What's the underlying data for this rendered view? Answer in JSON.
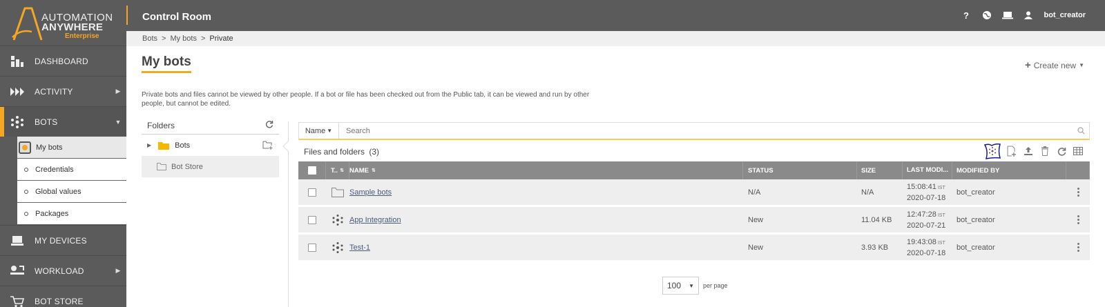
{
  "brand": {
    "line1": "AUTOMATION",
    "line2": "ANYWHERE",
    "line3": "Enterprise"
  },
  "topbar": {
    "title": "Control Room",
    "username": "bot_creator"
  },
  "sidebar": {
    "items": [
      {
        "label": "DASHBOARD",
        "icon": "dashboard-icon"
      },
      {
        "label": "ACTIVITY",
        "icon": "activity-icon"
      },
      {
        "label": "BOTS",
        "icon": "bots-icon"
      },
      {
        "label": "MY DEVICES",
        "icon": "devices-icon"
      },
      {
        "label": "WORKLOAD",
        "icon": "workload-icon"
      },
      {
        "label": "BOT STORE",
        "icon": "cart-icon"
      }
    ],
    "bots_sub": [
      {
        "label": "My bots"
      },
      {
        "label": "Credentials"
      },
      {
        "label": "Global values"
      },
      {
        "label": "Packages"
      }
    ]
  },
  "breadcrumb": {
    "b1": "Bots",
    "sep": ">",
    "b2": "My bots",
    "b3": "Private"
  },
  "page": {
    "title": "My bots",
    "create_new": "Create new",
    "description": "Private bots and files cannot be viewed by other people. If a bot or file has been checked out from the Public tab, it can be viewed and run by other people, but cannot be edited."
  },
  "folders": {
    "header": "Folders",
    "items": [
      {
        "label": "Bots"
      },
      {
        "label": "Bot Store"
      }
    ]
  },
  "search": {
    "filter": "Name",
    "placeholder": "Search"
  },
  "files": {
    "label": "Files and folders",
    "count": "(3)"
  },
  "table": {
    "headers": {
      "type": "T..",
      "name": "NAME",
      "status": "STATUS",
      "size": "SIZE",
      "modified": "LAST MODI...",
      "modified_by": "MODIFIED BY"
    },
    "rows": [
      {
        "type": "folder",
        "name": "Sample bots",
        "status": "N/A",
        "size": "N/A",
        "time": "15:08:41",
        "tz": "IST",
        "date": "2020-07-18",
        "by": "bot_creator"
      },
      {
        "type": "bot",
        "name": "App Integration",
        "status": "New",
        "size": "11.04 KB",
        "time": "12:47:28",
        "tz": "IST",
        "date": "2020-07-21",
        "by": "bot_creator"
      },
      {
        "type": "bot",
        "name": "Test-1",
        "status": "New",
        "size": "3.93 KB",
        "time": "19:43:08",
        "tz": "IST",
        "date": "2020-07-18",
        "by": "bot_creator"
      }
    ]
  },
  "pager": {
    "value": "100",
    "label": "per page"
  },
  "colors": {
    "accent": "#f5a623",
    "sidebar": "#5b5b5b",
    "header_row": "#8a8a8a"
  }
}
